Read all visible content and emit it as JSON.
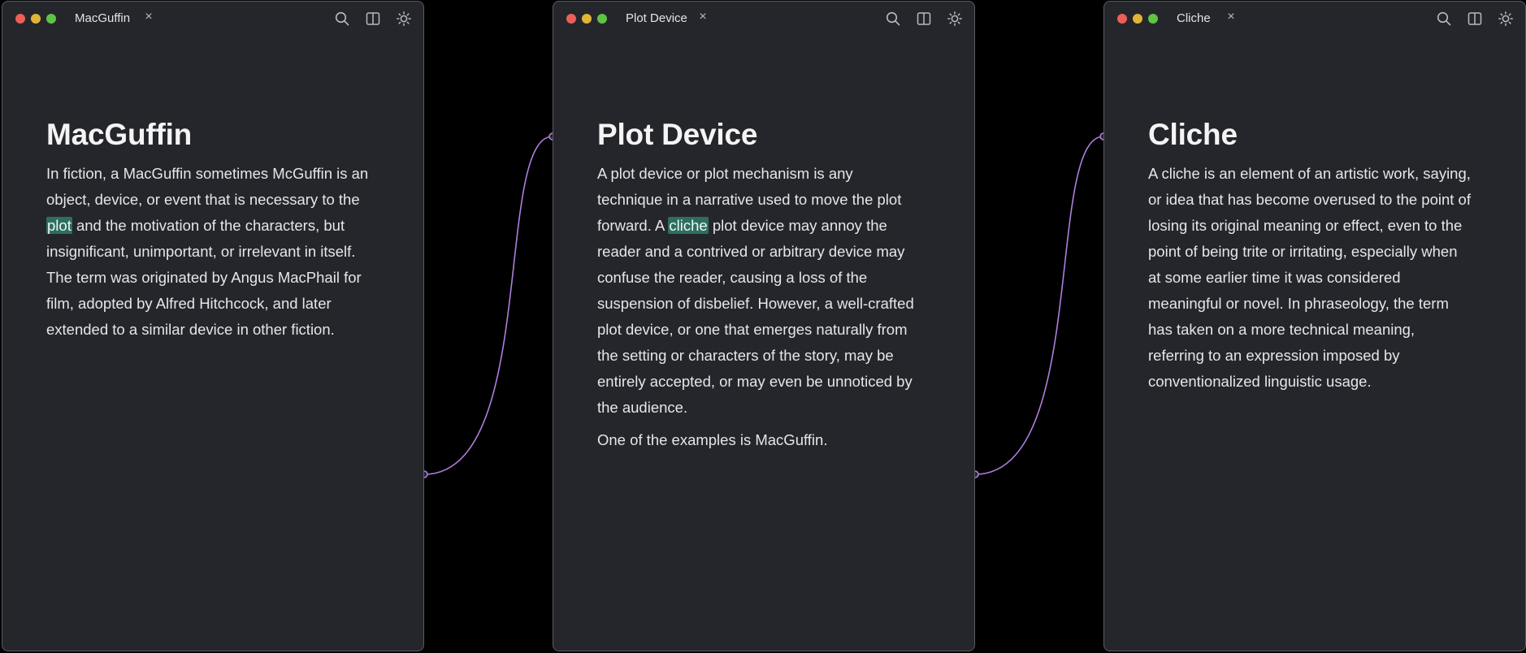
{
  "windows": [
    {
      "tab_title": "MacGuffin",
      "close_glyph": "×",
      "doc_title": "MacGuffin",
      "paragraphs": [
        {
          "before": "In fiction, a MacGuffin sometimes McGuffin is an object, device, or event that is necessary to the ",
          "highlight": "plot",
          "after": " and the motivation of the characters, but insignificant, unimportant, or irrelevant in itself. The term was originated by Angus MacPhail for film, adopted by Alfred Hitchcock, and later extended to a similar device in other fiction."
        }
      ]
    },
    {
      "tab_title": "Plot Device",
      "close_glyph": "×",
      "doc_title": "Plot Device",
      "paragraphs": [
        {
          "before": "A plot device or plot mechanism is any technique in a narrative used to move the plot forward.   A ",
          "highlight": "cliche",
          "after": " plot device may annoy the reader and a contrived or arbitrary device may confuse the reader, causing a loss of the suspension of disbelief. However, a well-crafted plot device, or one that emerges naturally from the setting or characters of the story, may be entirely accepted, or may even be unnoticed by the audience."
        },
        {
          "before": "One of the examples is MacGuffin.",
          "highlight": "",
          "after": ""
        }
      ]
    },
    {
      "tab_title": "Cliche",
      "close_glyph": "×",
      "doc_title": "Cliche",
      "paragraphs": [
        {
          "before": "A cliche is an element of an artistic work, saying, or idea that has become overused to the point of losing its original meaning or effect, even to the point of being trite or irritating, especially when at some earlier time it was considered meaningful or novel.   In phraseology, the term has taken on a more technical meaning, referring to an expression imposed by conventionalized linguistic usage.",
          "highlight": "",
          "after": ""
        }
      ]
    }
  ],
  "toolbar_icons": [
    "search-icon",
    "split-view-icon",
    "theme-toggle-icon"
  ],
  "link_connections": [
    {
      "from": "MacGuffin",
      "to": "Plot Device"
    },
    {
      "from": "Plot Device",
      "to": "Cliche"
    }
  ],
  "colors": {
    "app_background": "#000000",
    "window_background": "#25262b",
    "window_border": "#5a5c63",
    "text": "#e6e6e8",
    "title_text": "#f4f4f5",
    "highlight": "#2e6e62",
    "link_curve": "#b07ee0",
    "close_button": "#ec5f57",
    "minimize_button": "#e0b437",
    "zoom_button": "#5fc446"
  }
}
